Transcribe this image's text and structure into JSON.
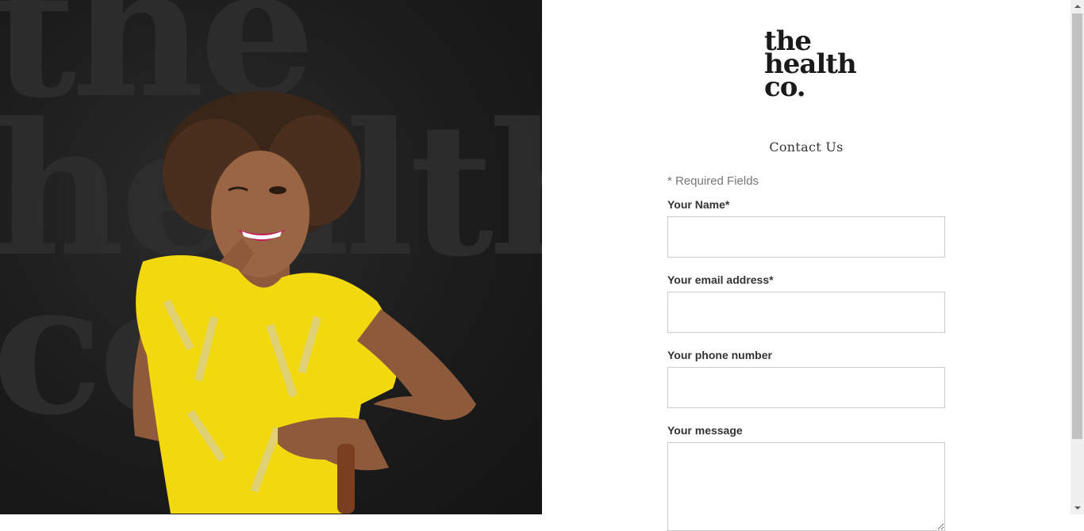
{
  "brand": {
    "logo_lines": [
      "the",
      "health",
      "co."
    ]
  },
  "page": {
    "title": "Contact Us"
  },
  "form": {
    "required_note": "* Required Fields",
    "name": {
      "label": "Your Name",
      "required_mark": "*",
      "value": ""
    },
    "email": {
      "label": "Your email address",
      "required_mark": "*",
      "value": ""
    },
    "phone": {
      "label": "Your phone number",
      "value": ""
    },
    "message": {
      "label": "Your message",
      "value": ""
    }
  },
  "hero": {
    "image": "woman-in-yellow-dress-photo"
  },
  "colors": {
    "hero_background": "#1c1c1c",
    "dress": "#f2d80f",
    "text_dark": "#333333",
    "input_border": "#cccccc"
  }
}
